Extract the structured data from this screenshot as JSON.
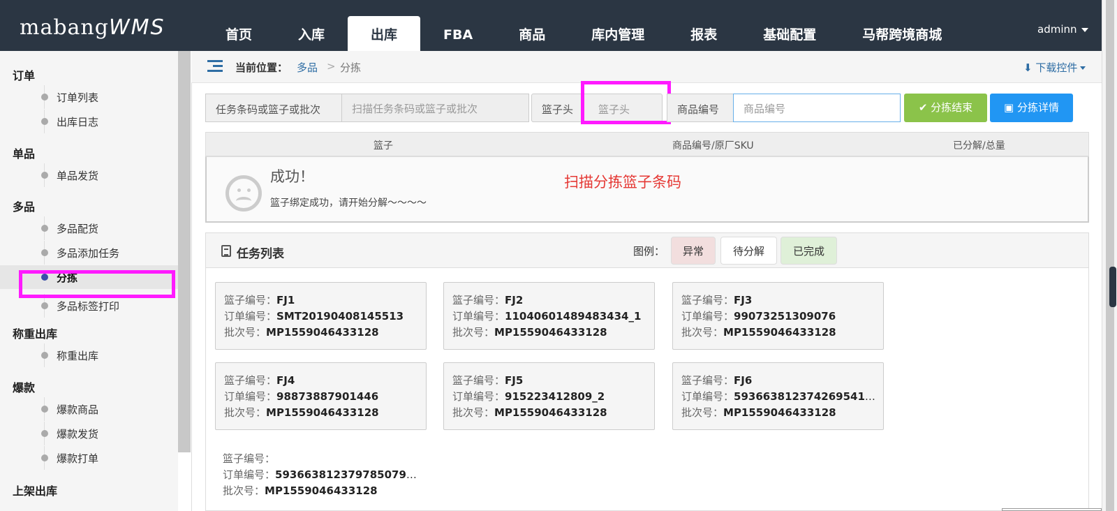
{
  "app": {
    "logo_main": "mabang",
    "logo_sub": "WMS",
    "user": "adminn"
  },
  "nav": [
    {
      "label": "首页",
      "active": false
    },
    {
      "label": "入库",
      "active": false
    },
    {
      "label": "出库",
      "active": true
    },
    {
      "label": "FBA",
      "active": false
    },
    {
      "label": "商品",
      "active": false
    },
    {
      "label": "库内管理",
      "active": false
    },
    {
      "label": "报表",
      "active": false
    },
    {
      "label": "基础配置",
      "active": false
    },
    {
      "label": "马帮跨境商城",
      "active": false
    }
  ],
  "sidebar": {
    "groups": [
      {
        "label": "订单",
        "items": [
          "订单列表",
          "出库日志"
        ]
      },
      {
        "label": "单品",
        "items": [
          "单品发货"
        ]
      },
      {
        "label": "多品",
        "items": [
          "多品配货",
          "多品添加任务",
          "分拣",
          "多品标签打印"
        ]
      },
      {
        "label": "称重出库",
        "items": [
          "称重出库"
        ]
      },
      {
        "label": "爆款",
        "items": [
          "爆款商品",
          "爆款发货",
          "爆款打单"
        ]
      },
      {
        "label": "上架出库",
        "items": []
      }
    ],
    "active_item": "分拣"
  },
  "breadcrumb": {
    "prefix": "当前位置：",
    "parent": "多品",
    "separator": ">",
    "current": "分拣",
    "download": "下载控件"
  },
  "form": {
    "task_label": "任务条码或篮子或批次",
    "task_placeholder": "扫描任务条码或篮子或批次",
    "basket_label": "篮子头",
    "basket_placeholder": "篮子头",
    "sku_label": "商品编号",
    "sku_placeholder": "商品编号",
    "finish_button": "分拣结束",
    "detail_button": "分拣详情"
  },
  "table_header": {
    "col1": "篮子",
    "col2": "商品编号/原厂SKU",
    "col3": "已分解/总量"
  },
  "message": {
    "title": "成功！",
    "subtitle": "篮子绑定成功，请开始分解～～～～",
    "prompt": "扫描分拣篮子条码"
  },
  "tasks": {
    "title": "任务列表",
    "legend_label": "图例：",
    "legend": [
      "异常",
      "待分解",
      "已完成"
    ],
    "key_basket": "篮子编号：",
    "key_order": "订单编号：",
    "key_batch": "批次号：",
    "cards": [
      {
        "basket": "FJ1",
        "order": "SMT20190408145513",
        "batch": "MP1559046433128"
      },
      {
        "basket": "FJ2",
        "order": "11040601489483434_1",
        "batch": "MP1559046433128"
      },
      {
        "basket": "FJ3",
        "order": "99073251309076",
        "batch": "MP1559046433128"
      },
      {
        "basket": "FJ4",
        "order": "98873887901446",
        "batch": "MP1559046433128"
      },
      {
        "basket": "FJ5",
        "order": "915223412809_2",
        "batch": "MP1559046433128"
      },
      {
        "basket": "FJ6",
        "order": "5936638123742695414...",
        "batch": "MP1559046433128"
      },
      {
        "basket": "",
        "order": "5936638123797850791...",
        "batch": "MP1559046433128"
      }
    ]
  },
  "colors": {
    "topbar": "#2b3643",
    "highlight": "#ff1aff",
    "green": "#8bc34a",
    "blue": "#2196f3",
    "red_text": "#e53935"
  }
}
